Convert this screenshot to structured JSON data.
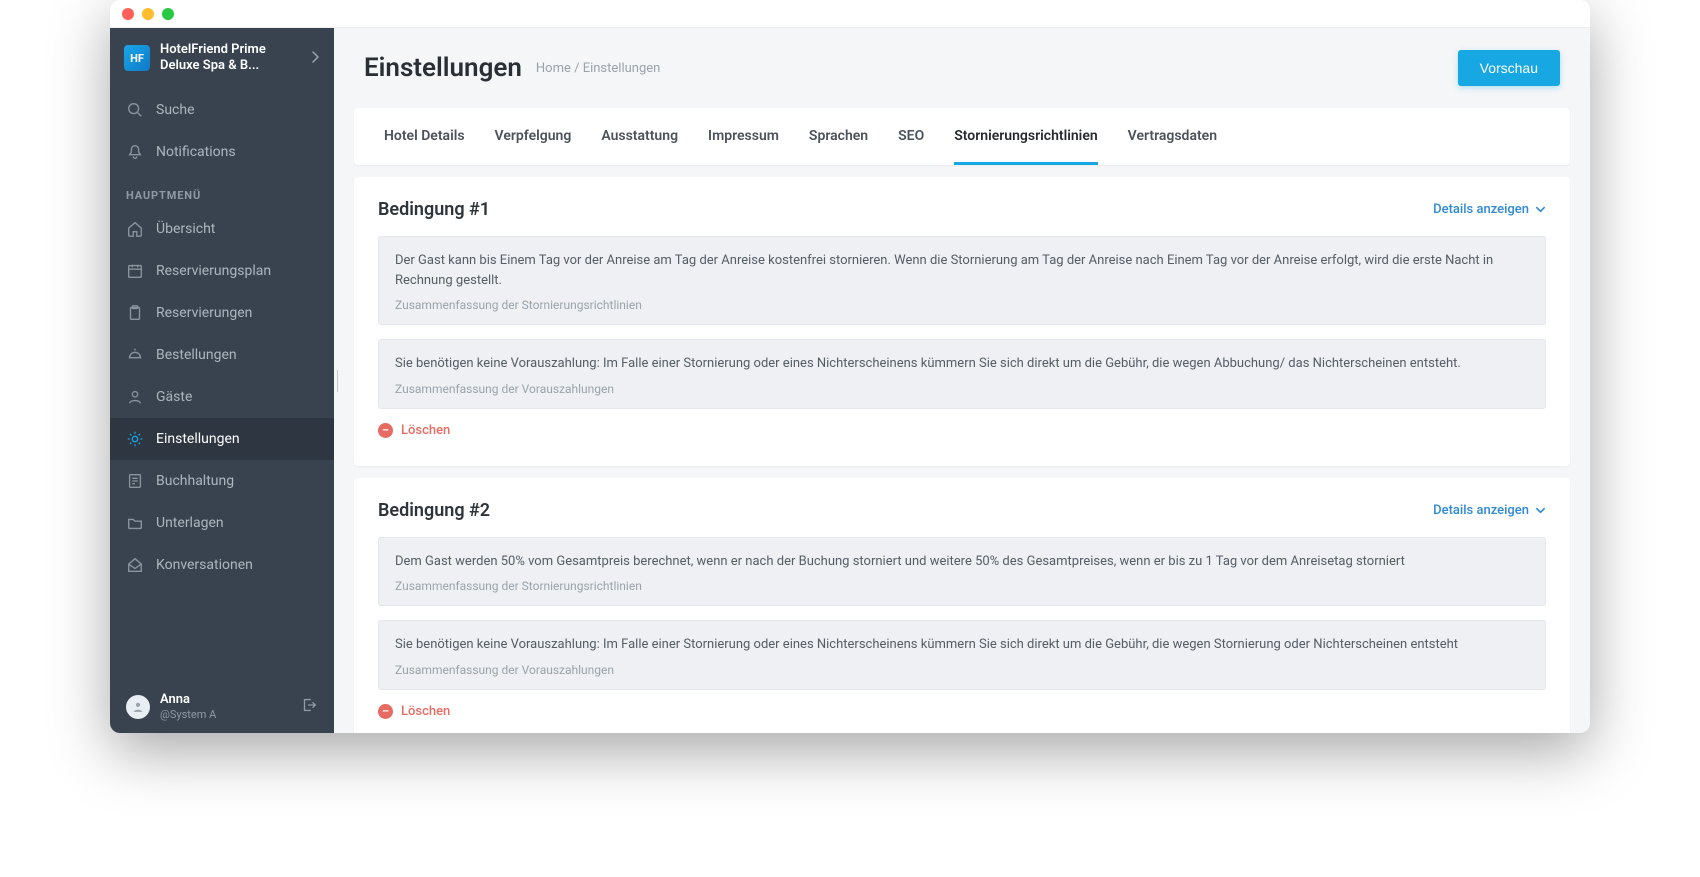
{
  "hotel": {
    "line1": "HotelFriend Prime",
    "line2": "Deluxe Spa & B..."
  },
  "sidebar": {
    "search": "Suche",
    "notifications": "Notifications",
    "section": "HAUPTMENÜ",
    "items": [
      {
        "label": "Übersicht"
      },
      {
        "label": "Reservierungsplan"
      },
      {
        "label": "Reservierungen"
      },
      {
        "label": "Bestellungen"
      },
      {
        "label": "Gäste"
      },
      {
        "label": "Einstellungen"
      },
      {
        "label": "Buchhaltung"
      },
      {
        "label": "Unterlagen"
      },
      {
        "label": "Konversationen"
      }
    ],
    "user": {
      "name": "Anna",
      "role": "@System A"
    }
  },
  "header": {
    "title": "Einstellungen",
    "crumb_home": "Home",
    "crumb_sep": " / ",
    "crumb_page": "Einstellungen",
    "preview": "Vorschau"
  },
  "tabs": [
    {
      "label": "Hotel Details"
    },
    {
      "label": "Verpfelgung"
    },
    {
      "label": "Ausstattung"
    },
    {
      "label": "Impressum"
    },
    {
      "label": "Sprachen"
    },
    {
      "label": "SEO"
    },
    {
      "label": "Stornierungsrichtlinien"
    },
    {
      "label": "Vertragsdaten"
    }
  ],
  "active_tab_index": 6,
  "details_label": "Details anzeigen",
  "delete_label": "Löschen",
  "summary_policy_caption": "Zusammenfassung der Stornierungsrichtlinien",
  "summary_prepay_caption": "Zusammenfassung der Vorauszahlungen",
  "conditions": [
    {
      "title": "Bedingung #1",
      "policy": "Der Gast kann bis Einem Tag vor der Anreise am Tag der Anreise kostenfrei stornieren. Wenn die Stornierung am Tag der Anreise nach Einem Tag vor der Anreise erfolgt, wird die erste Nacht in Rechnung gestellt.",
      "prepay": "Sie benötigen keine Vorauszahlung: Im Falle einer Stornierung oder eines Nichterscheinens kümmern Sie sich direkt um die Gebühr, die wegen Abbuchung/ das Nichterscheinen entsteht."
    },
    {
      "title": "Bedingung #2",
      "policy": "Dem Gast werden 50% vom Gesamtpreis berechnet, wenn er nach der Buchung storniert und weitere 50% des Gesamtpreises, wenn er bis zu 1 Tag vor dem Anreisetag storniert",
      "prepay": "Sie benötigen keine Vorauszahlung: Im Falle einer Stornierung oder eines Nichterscheinens kümmern Sie sich direkt um die Gebühr, die wegen Stornierung oder Nichterscheinen entsteht"
    }
  ]
}
